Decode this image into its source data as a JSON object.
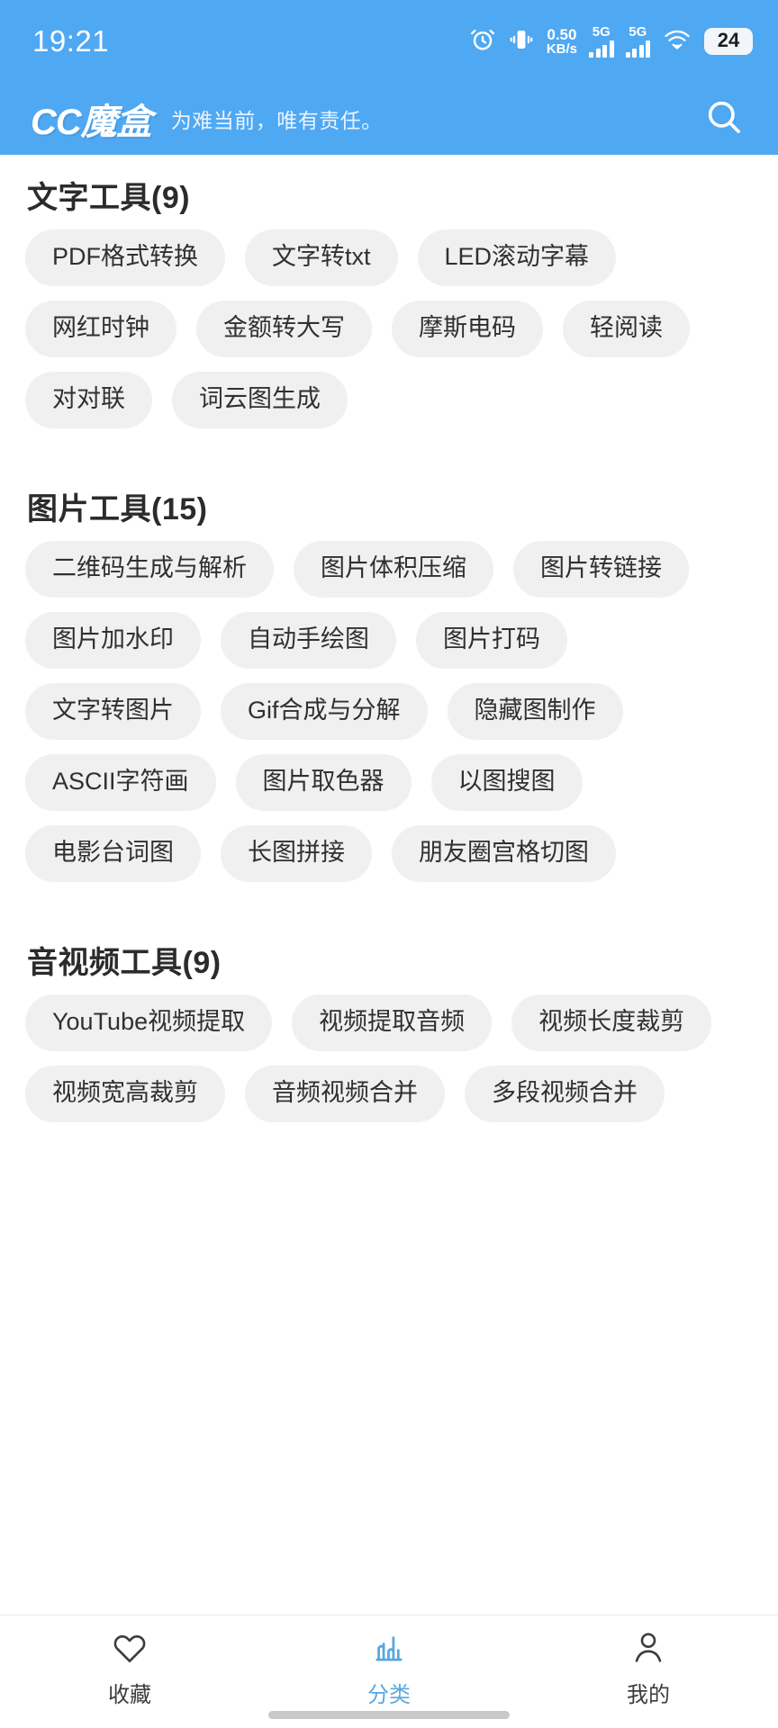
{
  "statusbar": {
    "time": "19:21",
    "net_speed_value": "0.50",
    "net_speed_unit": "KB/s",
    "sim1_network": "5G",
    "sim2_network": "5G",
    "battery_percent": "24",
    "icons": [
      "alarm-icon",
      "vibrate-icon",
      "signal-icon",
      "wifi-icon",
      "battery-icon"
    ]
  },
  "header": {
    "logo": "CC魔盒",
    "slogan": "为难当前，唯有责任。",
    "search_icon": "search-icon",
    "accent_color": "#4fa8f2"
  },
  "sections": [
    {
      "title": "文字工具(9)",
      "items": [
        "PDF格式转换",
        "文字转txt",
        "LED滚动字幕",
        "网红时钟",
        "金额转大写",
        "摩斯电码",
        "轻阅读",
        "对对联",
        "词云图生成"
      ]
    },
    {
      "title": "图片工具(15)",
      "items": [
        "二维码生成与解析",
        "图片体积压缩",
        "图片转链接",
        "图片加水印",
        "自动手绘图",
        "图片打码",
        "文字转图片",
        "Gif合成与分解",
        "隐藏图制作",
        "ASCII字符画",
        "图片取色器",
        "以图搜图",
        "电影台词图",
        "长图拼接",
        "朋友圈宫格切图"
      ]
    },
    {
      "title": "音视频工具(9)",
      "items": [
        "YouTube视频提取",
        "视频提取音频",
        "视频长度裁剪",
        "视频宽高裁剪",
        "音频视频合并",
        "多段视频合并"
      ]
    }
  ],
  "tabbar": {
    "active_color": "#57a8e0",
    "inactive_color": "#3c3c3c",
    "tabs": [
      {
        "label": "收藏",
        "icon": "heart-icon",
        "active": false
      },
      {
        "label": "分类",
        "icon": "bar-chart-icon",
        "active": true
      },
      {
        "label": "我的",
        "icon": "person-icon",
        "active": false
      }
    ]
  }
}
